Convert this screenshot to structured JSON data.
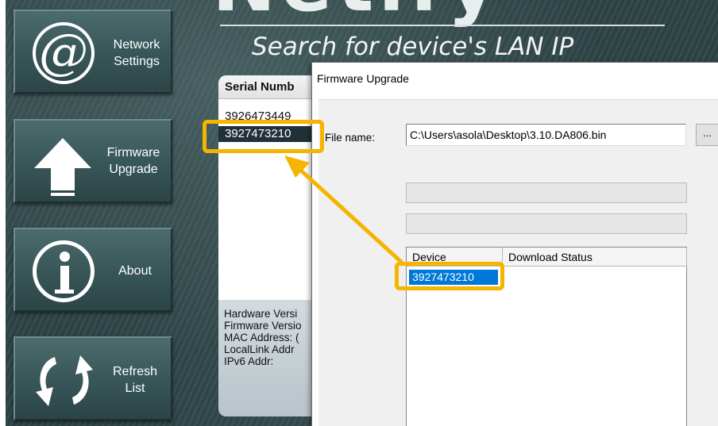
{
  "app": {
    "tagline": "Search for device's LAN IP"
  },
  "sidebar": {
    "network_label_line1": "Network",
    "network_label_line2": "Settings",
    "firmware_label_line1": "Firmware",
    "firmware_label_line2": "Upgrade",
    "about_label": "About",
    "refresh_label_line1": "Refresh",
    "refresh_label_line2": "List"
  },
  "device_list": {
    "column_header": "Serial Numb",
    "rows": [
      "3926473449",
      "3927473210"
    ],
    "selected_index": 1,
    "details": [
      "Hardware Versi",
      "Firmware Versio",
      "MAC Address: (",
      "LocalLink Addr",
      "IPv6 Addr:"
    ]
  },
  "dialog": {
    "title": "Firmware Upgrade",
    "file_label": "File name:",
    "file_value": "C:\\Users\\asola\\Desktop\\3.10.DA806.bin",
    "browse_label": "...",
    "columns": [
      "Device",
      "Download Status"
    ],
    "rows": [
      {
        "device": "3927473210",
        "status": ""
      }
    ]
  },
  "colors": {
    "highlight": "#f5b400",
    "selection": "#0078d7",
    "app_background": "#2e4446"
  }
}
